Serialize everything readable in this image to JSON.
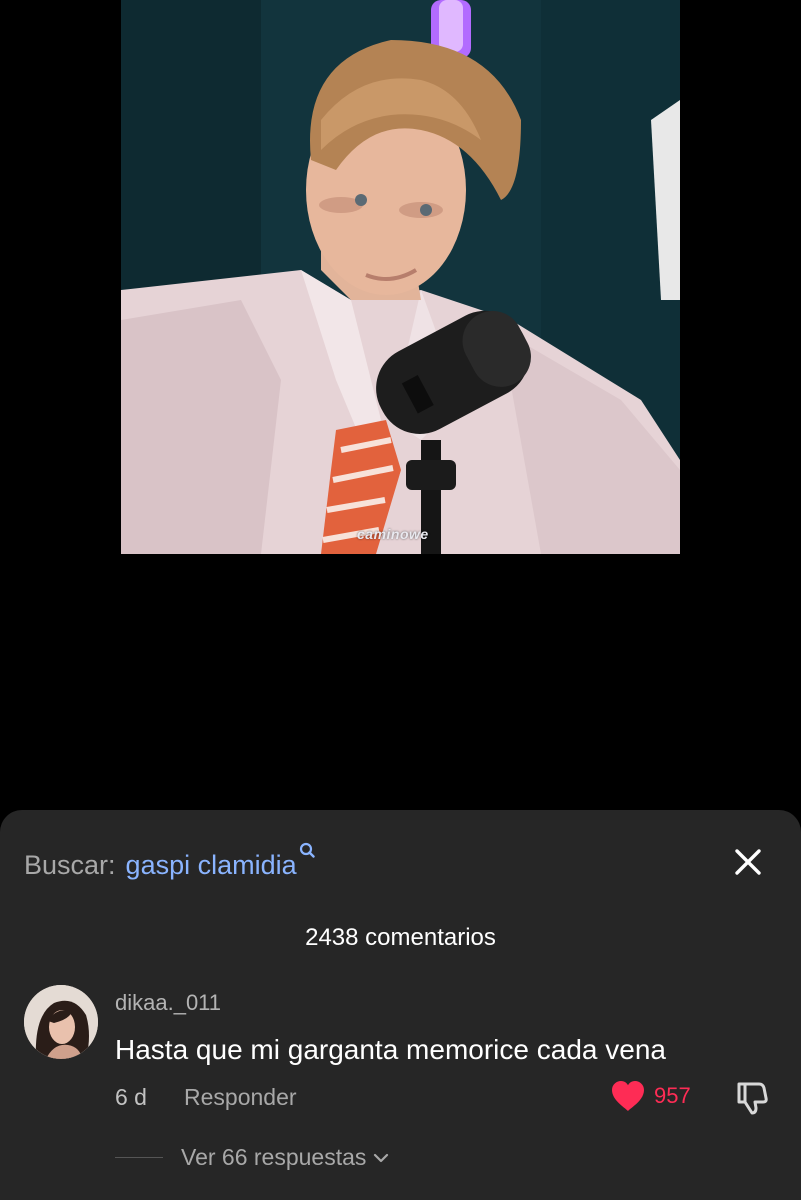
{
  "video": {
    "watermark": "caminowe"
  },
  "comments_sheet": {
    "search_prefix": "Buscar:",
    "search_term": "gaspi clamidia",
    "comment_count_label": "2438 comentarios",
    "comment": {
      "username": "dikaa._011",
      "text": "Hasta que mi garganta memorice cada vena",
      "time": "6 d",
      "reply_label": "Responder",
      "like_count": "957",
      "view_replies_label": "Ver 66 respuestas"
    }
  },
  "colors": {
    "sheet_background": "#262626",
    "search_term": "#8ab4ff",
    "like_red": "#fe2c55",
    "muted_text": "#a8a8a8"
  },
  "icons": {
    "search": "search-icon",
    "close": "close-icon",
    "like": "heart-icon",
    "dislike": "thumbs-down-icon",
    "expand": "chevron-down-icon"
  }
}
